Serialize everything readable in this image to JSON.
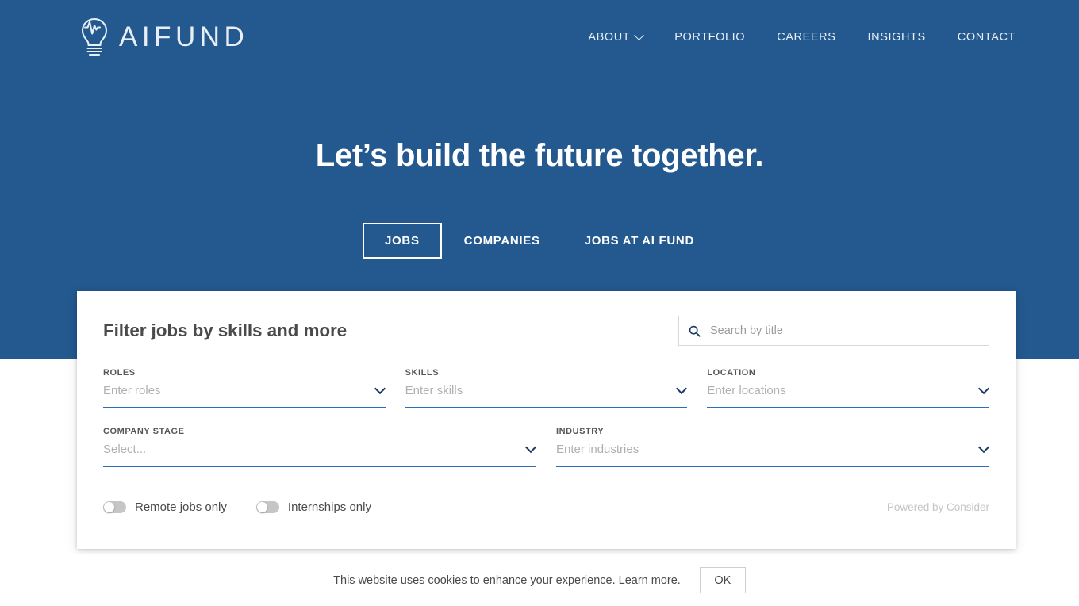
{
  "colors": {
    "hero_blue": "#23598f",
    "accent_underline": "#2a6ebb",
    "chevron_navy": "#1b3a63",
    "text_dark": "#4a4a4a",
    "placeholder_gray": "#b0b0b0"
  },
  "header": {
    "logo_text": "AIFUND",
    "logo_icon": "lightbulb-icon",
    "nav": [
      {
        "label": "ABOUT",
        "has_dropdown": true,
        "icon": "chevron-down-icon"
      },
      {
        "label": "PORTFOLIO",
        "has_dropdown": false
      },
      {
        "label": "CAREERS",
        "has_dropdown": false
      },
      {
        "label": "INSIGHTS",
        "has_dropdown": false
      },
      {
        "label": "CONTACT",
        "has_dropdown": false
      }
    ]
  },
  "hero": {
    "headline": "Let’s build the future together.",
    "tabs": [
      {
        "label": "JOBS",
        "active": true
      },
      {
        "label": "COMPANIES",
        "active": false
      },
      {
        "label": "JOBS AT AI FUND",
        "active": false
      }
    ]
  },
  "filter_card": {
    "title": "Filter jobs by skills and more",
    "search": {
      "icon": "search-icon",
      "placeholder": "Search by title",
      "value": ""
    },
    "fields": [
      {
        "label": "ROLES",
        "placeholder": "Enter roles",
        "value": "",
        "icon": "chevron-down-icon"
      },
      {
        "label": "SKILLS",
        "placeholder": "Enter skills",
        "value": "",
        "icon": "chevron-down-icon"
      },
      {
        "label": "LOCATION",
        "placeholder": "Enter locations",
        "value": "",
        "icon": "chevron-down-icon"
      },
      {
        "label": "COMPANY STAGE",
        "placeholder": "Select...",
        "value": "",
        "icon": "chevron-down-icon"
      },
      {
        "label": "INDUSTRY",
        "placeholder": "Enter industries",
        "value": "",
        "icon": "chevron-down-icon"
      }
    ],
    "toggles": [
      {
        "label": "Remote jobs only",
        "on": false
      },
      {
        "label": "Internships only",
        "on": false
      }
    ],
    "powered_by": "Powered by Consider"
  },
  "cookie_banner": {
    "message": "This website uses cookies to enhance your experience.",
    "link_label": "Learn more.",
    "ok_label": "OK"
  }
}
